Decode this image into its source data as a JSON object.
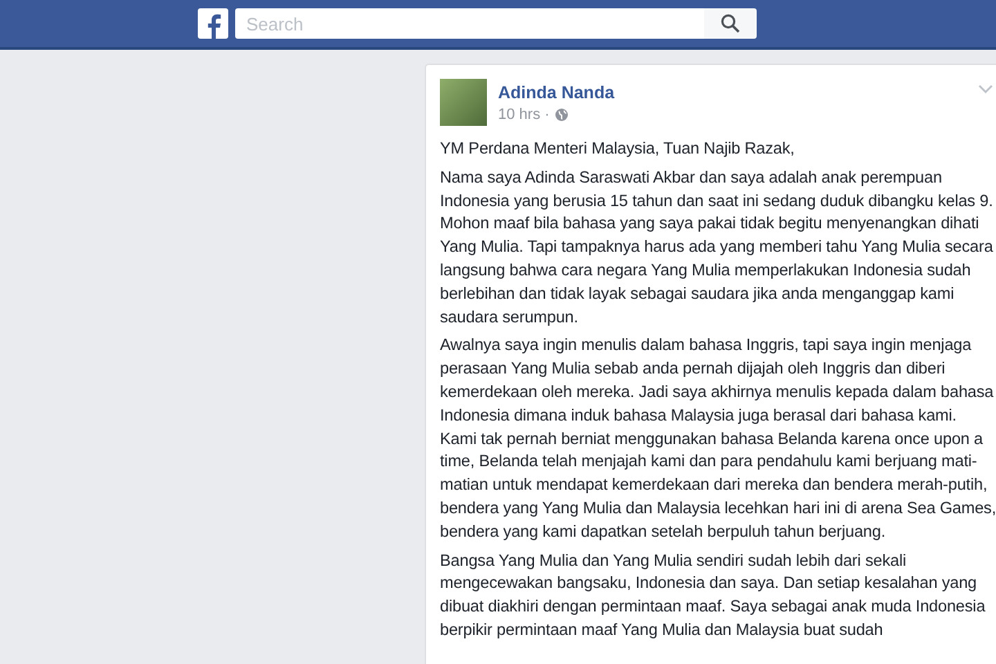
{
  "search": {
    "placeholder": "Search"
  },
  "post": {
    "author": "Adinda Nanda",
    "time": "10 hrs ·",
    "paragraphs": [
      "YM Perdana Menteri Malaysia, Tuan Najib Razak,",
      "Nama saya Adinda Saraswati Akbar dan saya adalah anak perempuan Indonesia yang berusia 15 tahun dan saat ini sedang duduk dibangku kelas 9. Mohon maaf bila bahasa yang saya pakai tidak begitu menyenangkan dihati Yang Mulia. Tapi tampaknya harus ada yang memberi tahu Yang Mulia secara langsung bahwa cara negara Yang Mulia memperlakukan Indonesia sudah berlebihan dan tidak layak sebagai saudara jika anda menganggap kami saudara serumpun.",
      "Awalnya saya ingin menulis dalam bahasa Inggris, tapi saya ingin menjaga perasaan Yang Mulia sebab anda pernah dijajah oleh Inggris dan diberi kemerdekaan oleh mereka. Jadi saya akhirnya menulis kepada dalam bahasa Indonesia dimana induk bahasa Malaysia juga berasal dari bahasa kami. Kami tak pernah berniat menggunakan bahasa Belanda karena once upon a time, Belanda telah menjajah kami dan para pendahulu kami berjuang mati-matian untuk mendapat kemerdekaan dari mereka dan bendera merah-putih, bendera yang Yang Mulia dan Malaysia lecehkan hari ini di arena Sea Games, bendera yang kami dapatkan setelah berpuluh tahun berjuang.",
      "Bangsa Yang Mulia dan Yang Mulia sendiri sudah lebih dari sekali mengecewakan bangsaku, Indonesia dan saya. Dan setiap kesalahan yang dibuat diakhiri dengan permintaan maaf. Saya sebagai anak muda Indonesia berpikir permintaan maaf Yang Mulia dan Malaysia buat sudah"
    ]
  }
}
